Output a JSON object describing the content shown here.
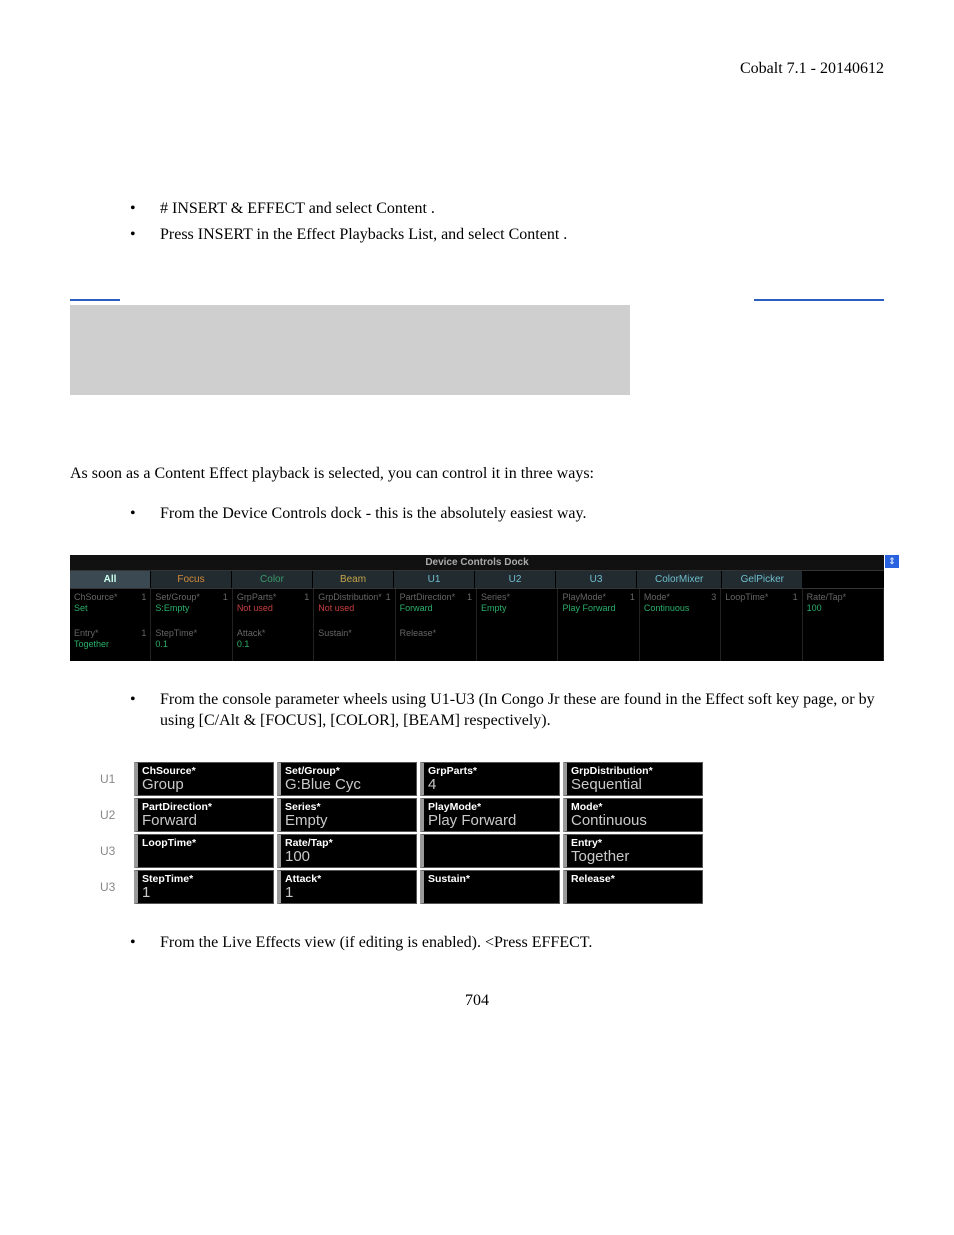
{
  "header": {
    "right": "Cobalt 7.1 - 20140612"
  },
  "bullets_top": [
    "# INSERT & EFFECT and select Content .",
    "Press INSERT in the Effect Playbacks List, and select Content ."
  ],
  "paragraph1": "As soon as a Content Effect playback is selected, you can control it in three ways:",
  "bullets_mid": [
    "From the Device Controls dock - this is the absolutely easiest way."
  ],
  "dock": {
    "title": "Device Controls Dock",
    "expand": "⇕",
    "tabs": [
      "All",
      "Focus",
      "Color",
      "Beam",
      "U1",
      "U2",
      "U3",
      "ColorMixer",
      "GelPicker"
    ],
    "row1": [
      {
        "l": "ChSource*",
        "n": "1",
        "v": "Set",
        "color": "g"
      },
      {
        "l": "Set/Group*",
        "n": "1",
        "v": "S:Empty",
        "color": "g"
      },
      {
        "l": "GrpParts*",
        "n": "1",
        "v": "Not used",
        "color": "r"
      },
      {
        "l": "GrpDistribution*",
        "n": "1",
        "v": "Not used",
        "color": "r"
      },
      {
        "l": "PartDirection*",
        "n": "1",
        "v": "Forward",
        "color": "g"
      },
      {
        "l": "Series*",
        "n": "",
        "v": "Empty",
        "color": "g"
      },
      {
        "l": "PlayMode*",
        "n": "1",
        "v": "Play Forward",
        "color": "g"
      },
      {
        "l": "Mode*",
        "n": "3",
        "v": "Continuous",
        "color": "g"
      },
      {
        "l": "LoopTime*",
        "n": "1",
        "v": "",
        "color": "g"
      },
      {
        "l": "Rate/Tap*",
        "n": "",
        "v": "100",
        "color": "g"
      }
    ],
    "row2": [
      {
        "l": "Entry*",
        "n": "1",
        "v": "Together",
        "color": "g"
      },
      {
        "l": "StepTime*",
        "n": "",
        "v": "0.1",
        "color": "g"
      },
      {
        "l": "Attack*",
        "n": "",
        "v": "0.1",
        "color": "g"
      },
      {
        "l": "Sustain*",
        "n": "",
        "v": "",
        "color": ""
      },
      {
        "l": "Release*",
        "n": "",
        "v": "",
        "color": ""
      },
      {
        "l": "",
        "n": "",
        "v": "",
        "color": ""
      },
      {
        "l": "",
        "n": "",
        "v": "",
        "color": ""
      },
      {
        "l": "",
        "n": "",
        "v": "",
        "color": ""
      },
      {
        "l": "",
        "n": "",
        "v": "",
        "color": ""
      },
      {
        "l": "",
        "n": "",
        "v": "",
        "color": ""
      }
    ]
  },
  "bullets_after_dock": [
    "From the console parameter wheels using U1-U3 (In Congo Jr these are found in the Effect soft key page, or by using [C/Alt & [FOCUS], [COLOR], [BEAM] respectively)."
  ],
  "wheels": [
    {
      "u": "U1",
      "cells": [
        {
          "h": "ChSource*",
          "v": "Group"
        },
        {
          "h": "Set/Group*",
          "v": "G:Blue Cyc"
        },
        {
          "h": "GrpParts*",
          "v": "4"
        },
        {
          "h": "GrpDistribution*",
          "v": "Sequential"
        }
      ]
    },
    {
      "u": "U2",
      "cells": [
        {
          "h": "PartDirection*",
          "v": "Forward"
        },
        {
          "h": "Series*",
          "v": "Empty"
        },
        {
          "h": "PlayMode*",
          "v": "Play Forward"
        },
        {
          "h": "Mode*",
          "v": "Continuous"
        }
      ]
    },
    {
      "u": "U3",
      "cells": [
        {
          "h": "LoopTime*",
          "v": ""
        },
        {
          "h": "Rate/Tap*",
          "v": "100"
        },
        {
          "h": "",
          "v": ""
        },
        {
          "h": "Entry*",
          "v": "Together"
        }
      ]
    },
    {
      "u": "U3",
      "cells": [
        {
          "h": "StepTime*",
          "v": "1"
        },
        {
          "h": "Attack*",
          "v": "1"
        },
        {
          "h": "Sustain*",
          "v": ""
        },
        {
          "h": "Release*",
          "v": ""
        }
      ]
    }
  ],
  "bullets_bottom": [
    "From the Live Effects view (if editing is enabled). <Press EFFECT."
  ],
  "pagenum": "704"
}
